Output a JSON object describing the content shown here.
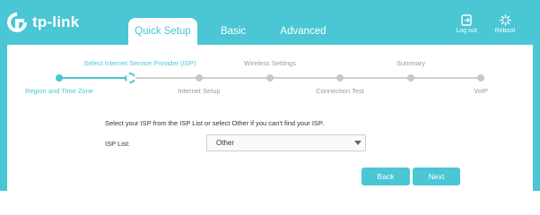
{
  "header": {
    "brand": "tp-link",
    "tabs": [
      {
        "label": "Quick Setup"
      },
      {
        "label": "Basic"
      },
      {
        "label": "Advanced"
      }
    ],
    "logout_label": "Log out",
    "reboot_label": "Reboot"
  },
  "steps": {
    "top": [
      {
        "label": "Select Internet Service Provider (ISP)"
      },
      {
        "label": "Wireless Settings"
      },
      {
        "label": "Summary"
      }
    ],
    "bottom": [
      {
        "label": "Region and Time Zone"
      },
      {
        "label": "Internet Setup"
      },
      {
        "label": "Connection Test"
      },
      {
        "label": "VoIP"
      }
    ],
    "current_step": 2,
    "total_steps": 7
  },
  "form": {
    "hint": "Select your ISP from the ISP List or select Other if you can't find your ISP.",
    "isp_label": "ISP List:",
    "isp_value": "Other"
  },
  "buttons": {
    "back": "Back",
    "next": "Next"
  },
  "colors": {
    "accent": "#4ac6d4",
    "inactive": "#c8c8c8"
  }
}
